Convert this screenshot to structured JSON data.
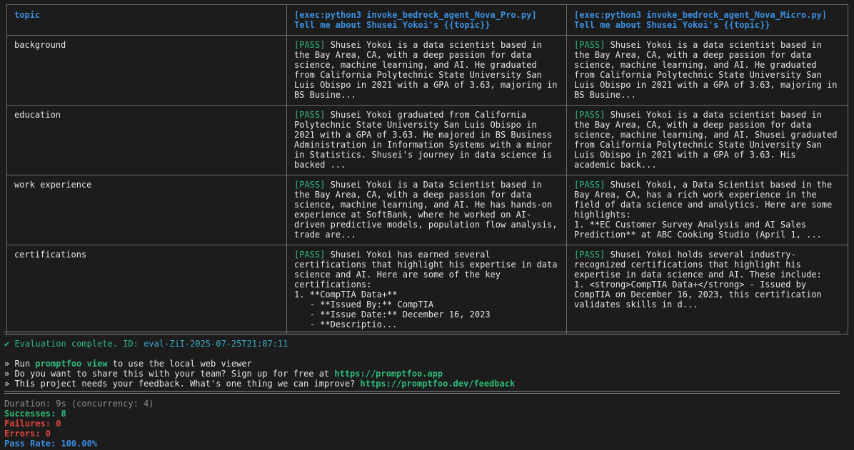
{
  "table": {
    "headers": [
      "topic",
      "[exec:python3 invoke_bedrock_agent_Nova_Pro.py] Tell me about Shusei Yokoi's {{topic}}",
      "[exec:python3 invoke_bedrock_agent_Nova_Micro.py] Tell me about Shusei Yokoi's {{topic}}"
    ],
    "rows": [
      {
        "topic": "background",
        "pro_status": "[PASS]",
        "pro_text": " Shusei Yokoi is a data scientist based in the Bay Area, CA, with a deep passion for data science, machine learning, and AI. He graduated from California Polytechnic State University San Luis Obispo in 2021 with a GPA of 3.63, majoring in BS Busine...",
        "micro_status": "[PASS]",
        "micro_text": " Shusei Yokoi is a data scientist based in the Bay Area, CA, with a deep passion for data science, machine learning, and AI. He graduated from California Polytechnic State University San Luis Obispo in 2021 with a GPA of 3.63, majoring in BS Busine..."
      },
      {
        "topic": "education",
        "pro_status": "[PASS]",
        "pro_text": " Shusei Yokoi graduated from California Polytechnic State University San Luis Obispo in 2021 with a GPA of 3.63. He majored in BS Business Administration in Information Systems with a minor in Statistics. Shusei's journey in data science is backed ...",
        "micro_status": "[PASS]",
        "micro_text": " Shusei Yokoi is a data scientist based in the Bay Area, CA, with a deep passion for data science, machine learning, and AI. Shusei graduated from California Polytechnic State University San Luis Obispo in 2021 with a GPA of 3.63. His academic back..."
      },
      {
        "topic": "work experience",
        "pro_status": "[PASS]",
        "pro_text": " Shusei Yokoi is a Data Scientist based in the Bay Area, CA, with a deep passion for data science, machine learning, and AI. He has hands-on experience at SoftBank, where he worked on AI-driven predictive models, population flow analysis, trade are...",
        "micro_status": "[PASS]",
        "micro_text": " Shusei Yokoi, a Data Scientist based in the Bay Area, CA, has a rich work experience in the field of data science and analytics. Here are some highlights:\n1. **EC Customer Survey Analysis and AI Sales Prediction** at ABC Cooking Studio (April 1, ..."
      },
      {
        "topic": "certifications",
        "pro_status": "[PASS]",
        "pro_text": " Shusei Yokoi has earned several certifications that highlight his expertise in data science and AI. Here are some of the key certifications:\n1. **CompTIA Data+**\n   - **Issued By:** CompTIA\n   - **Issue Date:** December 16, 2023\n   - **Descriptio...",
        "micro_status": "[PASS]",
        "micro_text": " Shusei Yokoi holds several industry-recognized certifications that highlight his expertise in data science and AI. These include:\n1. <strong>CompTIA Data+</strong> - Issued by CompTIA on December 16, 2023, this certification validates skills in d..."
      }
    ]
  },
  "summary": {
    "complete_prefix": "✔ Evaluation complete. ID: ",
    "eval_id": "eval-ZiI-2025-07-25T21:07:11",
    "run_prefix": "» Run ",
    "run_cmd": "promptfoo view",
    "run_suffix": " to use the local web viewer",
    "share_prefix": "» Do you want to share this with your team? Sign up for free at ",
    "share_url": "https://promptfoo.app",
    "feedback_prefix": "» This project needs your feedback. What's one thing we can improve? ",
    "feedback_url": "https://promptfoo.dev/feedback"
  },
  "stats": {
    "duration": "Duration: 9s (concurrency: 4)",
    "successes": "Successes: 8",
    "failures": "Failures: 0",
    "errors": "Errors: 0",
    "pass_rate": "Pass Rate: 100.00%"
  },
  "colors": {
    "background": "#1c1c1c",
    "header_blue": "#3d8fe0",
    "pass_green": "#2fb97a",
    "id_cyan": "#3aa9c4",
    "failure_red": "#e0463a"
  }
}
